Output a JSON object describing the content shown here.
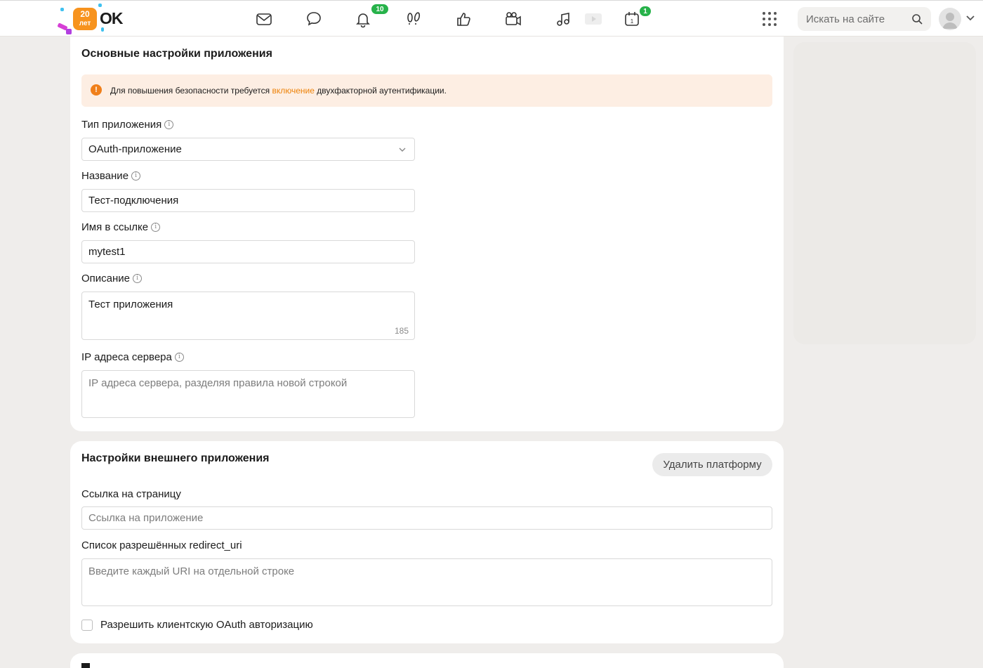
{
  "header": {
    "logo": {
      "badge_top": "20",
      "badge_bottom": "лет",
      "brand": "OK"
    },
    "nav_icons": [
      {
        "name": "messages-icon"
      },
      {
        "name": "discussions-icon"
      },
      {
        "name": "notifications-icon",
        "badge": "10"
      },
      {
        "name": "guests-icon"
      },
      {
        "name": "likes-icon"
      },
      {
        "name": "video-calls-icon"
      },
      {
        "name": "music-icon"
      },
      {
        "name": "video-icon"
      },
      {
        "name": "calendar-icon",
        "badge": "1"
      }
    ],
    "search_placeholder": "Искать на сайте",
    "accent_color": "#ee8208",
    "badge_color": "#27b24a"
  },
  "basic_settings": {
    "title": "Основные настройки приложения",
    "alert": {
      "before": "Для повышения безопасности требуется ",
      "link": "включение",
      "after": " двухфакторной аутентификации."
    },
    "app_type": {
      "label": "Тип приложения",
      "value": "OAuth-приложение"
    },
    "name": {
      "label": "Название",
      "value": "Тест-подключения"
    },
    "link_name": {
      "label": "Имя в ссылке",
      "value": "mytest1"
    },
    "description": {
      "label": "Описание",
      "value": "Тест приложения",
      "counter": "185"
    },
    "server_ips": {
      "label": "IP адреса сервера",
      "placeholder": "IP адреса сервера, разделяя правила новой строкой"
    }
  },
  "external_settings": {
    "title": "Настройки внешнего приложения",
    "delete_button": "Удалить платформу",
    "page_link": {
      "label": "Ссылка на страницу",
      "placeholder": "Ссылка на приложение"
    },
    "redirect_uris": {
      "label": "Список разрешённых redirect_uri",
      "placeholder": "Введите каждый URI на отдельной строке"
    },
    "client_oauth": {
      "label": "Разрешить клиентскую OAuth авторизацию",
      "checked": false
    }
  }
}
